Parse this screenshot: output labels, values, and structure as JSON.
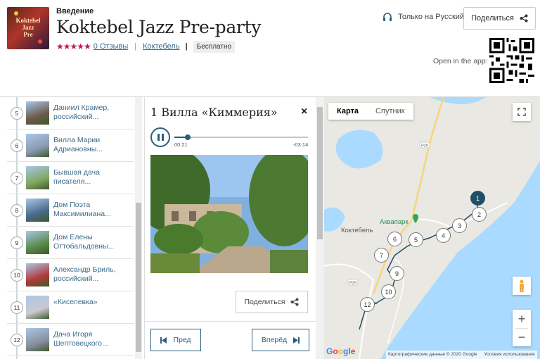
{
  "header": {
    "eyebrow": "Введение",
    "title": "Koktebel Jazz Pre-party",
    "cover_logo_text": "Koktebel Jazz Pre-party",
    "stars": "★★★★★",
    "reviews": "0 Отзывы",
    "location": "Коктебель",
    "price": "Бесплатно",
    "language": "Только на Русский",
    "share": "Поделиться",
    "open_app": "Open in the app:"
  },
  "stops": [
    {
      "num": "5",
      "label": "Даниил Крамер, российский..."
    },
    {
      "num": "6",
      "label": "Вилла Марии Адриановны..."
    },
    {
      "num": "7",
      "label": "Бывшая дача писателя..."
    },
    {
      "num": "8",
      "label": "Дом Поэта Максимилиана..."
    },
    {
      "num": "9",
      "label": "Дом Елены Оттобальдовны..."
    },
    {
      "num": "10",
      "label": "Александр Бриль, российский..."
    },
    {
      "num": "11",
      "label": "«Киселевка»"
    },
    {
      "num": "12",
      "label": "Дача Игоря Шептовецкого..."
    }
  ],
  "detail": {
    "title": "1 Вилла «Киммерия»",
    "close": "×",
    "time_current": "00:21",
    "time_remaining": "-03:14",
    "progress_fraction": 0.1,
    "share": "Поделиться",
    "prev": "Пред",
    "next": "Вперёд"
  },
  "map": {
    "tab_map": "Карта",
    "tab_satellite": "Спутник",
    "road_label": "P29",
    "place_aquapark": "Аквапарк",
    "place_town": "Коктебель",
    "copyright": "Картографические данные © 2020 Google",
    "terms": "Условия использования",
    "google": "Google",
    "markers": [
      "1",
      "2",
      "3",
      "4",
      "5",
      "6",
      "7",
      "9",
      "10",
      "12"
    ]
  },
  "colors": {
    "accent": "#2c5f7c",
    "stars": "#c2185b",
    "sea": "#aadaff"
  }
}
